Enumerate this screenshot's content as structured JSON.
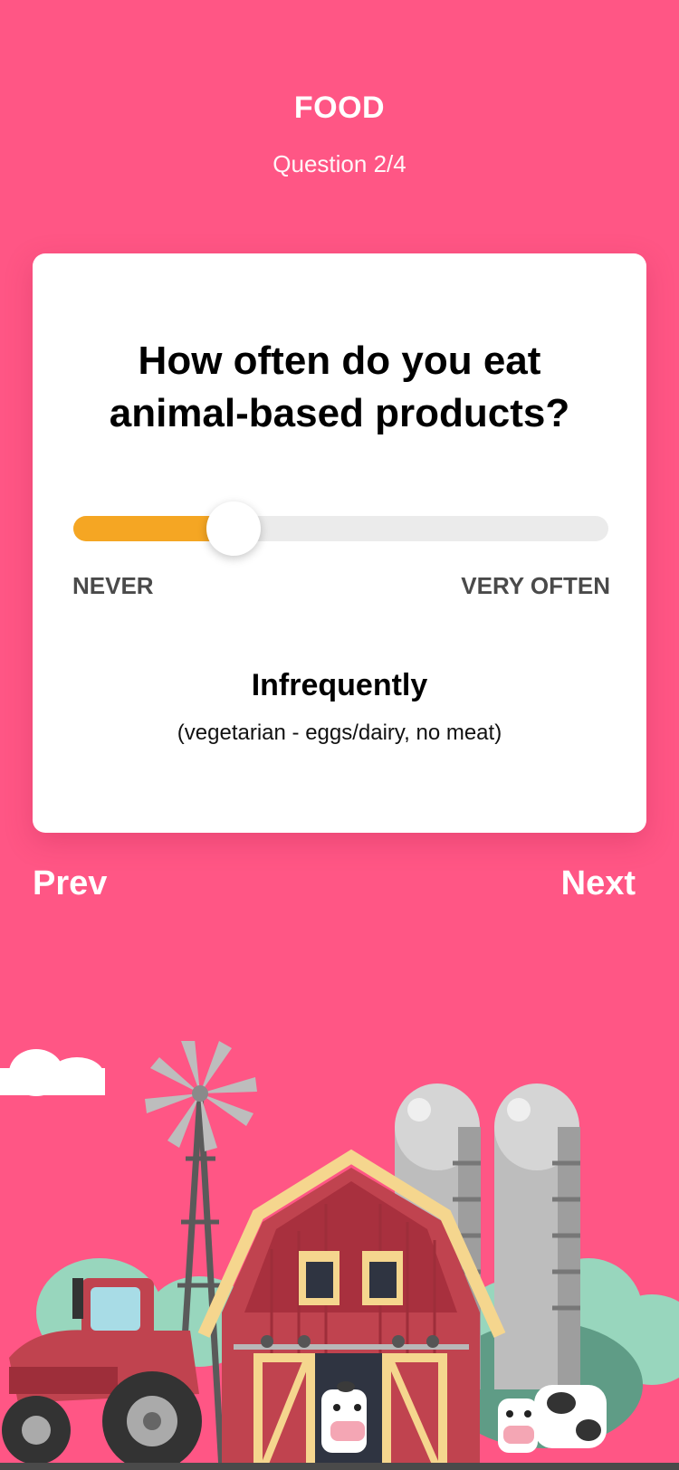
{
  "header": {
    "title": "FOOD",
    "subtitle": "Question 2/4"
  },
  "card": {
    "question": "How often do you eat animal-based products?",
    "slider": {
      "value_fraction": 0.3,
      "min_label": "NEVER",
      "max_label": "VERY OFTEN"
    },
    "answer": {
      "title": "Infrequently",
      "description": "(vegetarian - eggs/dairy, no meat)"
    }
  },
  "nav": {
    "prev_label": "Prev",
    "next_label": "Next"
  },
  "colors": {
    "background": "#FF5685",
    "accent": "#F5A623",
    "card": "#FFFFFF"
  },
  "illustration": {
    "subject": "farm scene with windmill, barn, silos, tractor and cows"
  }
}
